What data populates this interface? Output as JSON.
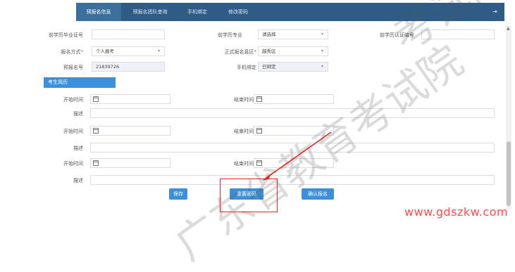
{
  "nav": {
    "tabs": [
      "预报名信息",
      "预报名团队查询",
      "手机绑定",
      "修改密码"
    ],
    "active_index": 0
  },
  "form": {
    "degree_cert_label": "前学历毕业证号",
    "degree_major_label": "前学历专业",
    "degree_major_value": "请选择",
    "degree_auth_label": "前学历认证编号",
    "signup_mode_label": "报名方式",
    "signup_mode_value": "个人报考",
    "official_region_label": "正式报名县区",
    "official_region_value": "越秀区",
    "prereg_no_label": "预报名号",
    "prereg_no_value": "21839726",
    "phone_bind_label": "手机绑定",
    "phone_bind_value": "已绑定"
  },
  "resume": {
    "section_title": "考生简历",
    "rows": [
      {
        "start_label": "开始时间",
        "end_label": "结束时间",
        "desc_label": "描述"
      },
      {
        "start_label": "开始时间",
        "end_label": "结束时间",
        "desc_label": "描述"
      },
      {
        "start_label": "开始时间",
        "end_label": "结束时间",
        "desc_label": "描述"
      }
    ]
  },
  "buttons": {
    "save": "保存",
    "reset": "重置密码",
    "confirm": "确认报名"
  },
  "watermark": {
    "line1": "考试院",
    "line2": "广东省教育考试院",
    "site": "www.gdszkw.com"
  },
  "colors": {
    "nav_bg": "#2e5c86",
    "accent": "#3c8fd8",
    "highlight": "#e12424",
    "site_mark": "#ff4a4a"
  },
  "icons": [
    "exit-icon",
    "calendar-icon",
    "caret-down-icon",
    "scroll-up-icon"
  ]
}
